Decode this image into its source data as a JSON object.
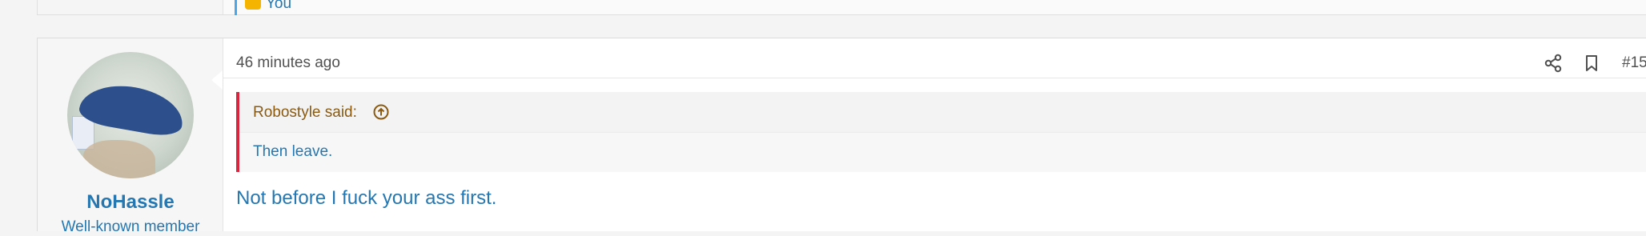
{
  "previous_post": {
    "reaction_text": "You"
  },
  "post": {
    "user": {
      "name": "NoHassle",
      "title": "Well-known member"
    },
    "timestamp": "46 minutes ago",
    "post_number": "#15",
    "quote": {
      "author": "Robostyle said:",
      "text": "Then leave."
    },
    "message": "Not before I fuck your ass first."
  },
  "icons": {
    "share": "share-icon",
    "bookmark": "bookmark-icon",
    "quote_jump": "arrow-up-circle-icon"
  },
  "colors": {
    "link": "#2577b1",
    "quote_border": "#d8263e",
    "quote_author": "#8a5a11",
    "muted": "#505050"
  }
}
